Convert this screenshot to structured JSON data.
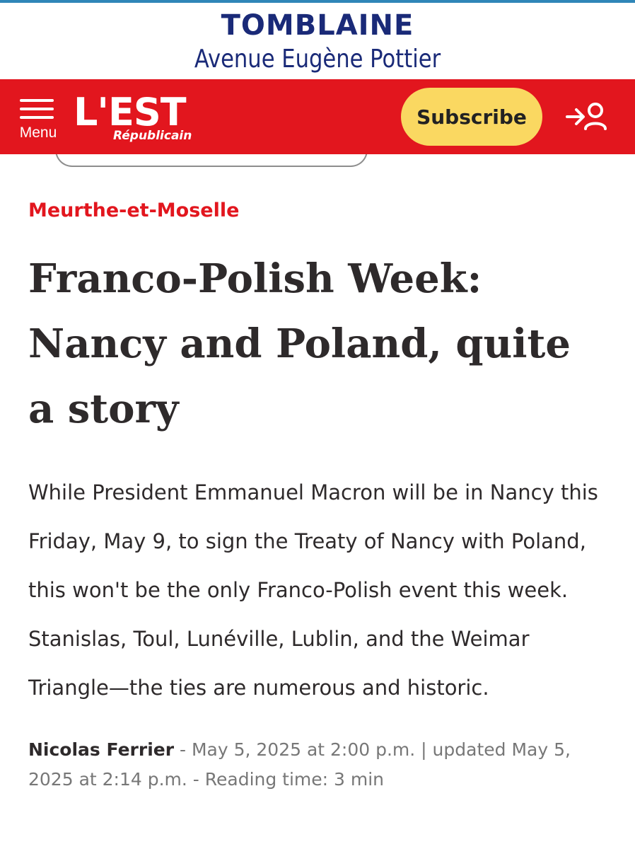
{
  "banner": {
    "city": "TOMBLAINE",
    "street": "Avenue Eugène Pottier"
  },
  "header": {
    "menu_label": "Menu",
    "logo_main": "L'EST",
    "logo_sub": "Républicain",
    "subscribe_label": "Subscribe",
    "login_icon": "login-user-icon",
    "background_color": "#e2161e",
    "subscribe_color": "#fad861"
  },
  "article": {
    "section": "Meurthe-et-Moselle",
    "title": "Franco-Polish Week: Nancy and Poland, quite a story",
    "standfirst": "While President Emmanuel Macron will be in Nancy this Friday, May 9, to sign the Treaty of Nancy with Poland, this won't be the only Franco-Polish event this week. Stanislas, Toul, Lunéville, Lublin, and the Weimar Triangle—the ties are numerous and historic.",
    "author": "Nicolas Ferrier",
    "meta": " - May 5, 2025 at 2:00 p.m. | updated May 5, 2025 at 2:14 p.m. - Reading time: 3 min"
  }
}
